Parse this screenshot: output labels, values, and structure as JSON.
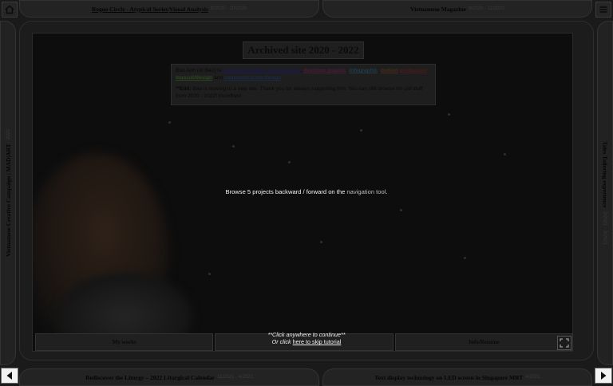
{
  "top_tabs": {
    "left": {
      "title": "Rogue Circle - Atypical Series",
      "sep": " | ",
      "subtitle": "Visual Analysis",
      "date": "9/2020 - 10/2020"
    },
    "right": {
      "title": "Vietnamese Magazine",
      "date": "9/2020 - 11/2020"
    }
  },
  "bottom_tabs": {
    "left": {
      "title": "Rediscover the Liturgy – 2022 Liturgical Calendar",
      "date": "11/2021 - 4/2022"
    },
    "right": {
      "title": "Text display technology on LED screen in Singapore MRT",
      "date": "4/2021"
    }
  },
  "side_tabs": {
    "left": {
      "title": "Vietnamese Creative Campaign | MAD|ART",
      "date": "2020"
    },
    "right": {
      "title": "Tales Tailoring experience",
      "date": "2/2021 - 3/2021"
    }
  },
  "main": {
    "title": "Archived site 2020 - 2022",
    "intro": {
      "lead": "Bao Anh (or Bao) is ",
      "links": [
        "material design & development",
        "direction graphic",
        "infographic",
        "motion",
        "production",
        "mascot/design",
        "communication design"
      ],
      "and": " and ",
      "edit_label": "**Edit:",
      "edit_text": " Bao is moving to a new site. Thank you for always supporting him. You can still browse his old stuff from 2020 - 2022! Goodbye!"
    },
    "browse": {
      "prefix": "Browse 5 projects backward / forward on the ",
      "nav": "navigation tool",
      "suffix": "."
    }
  },
  "bottom_bar": {
    "left": "My works",
    "middle": "",
    "right": "Info/Resume"
  },
  "tutorial": {
    "line1": "**Click anywhere to continue**",
    "line2_prefix": "Or click ",
    "line2_link": "here to skip tutorial"
  },
  "icons": {
    "home": "home-icon",
    "menu": "menu-icon",
    "prev": "arrow-left-icon",
    "next": "arrow-right-icon",
    "fullscreen": "fullscreen-icon"
  },
  "colors": {
    "overlay": "#111111",
    "text_light": "#f2f2f2",
    "nav_button": "#f2f2f2"
  }
}
